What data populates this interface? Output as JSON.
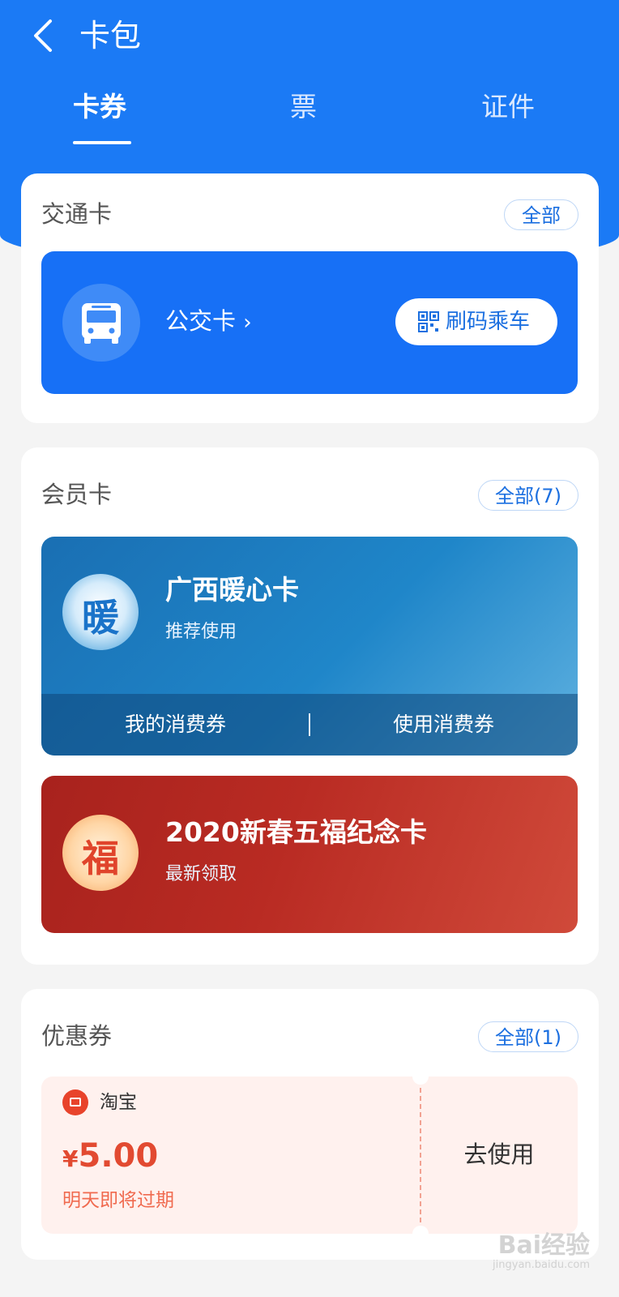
{
  "header": {
    "title": "卡包"
  },
  "tabs": [
    {
      "label": "卡券"
    },
    {
      "label": "票"
    },
    {
      "label": "证件"
    }
  ],
  "transit": {
    "section_title": "交通卡",
    "all_label": "全部",
    "bus_card_label": "公交卡",
    "ride_button": "刷码乘车",
    "icon": "bus-icon"
  },
  "membership": {
    "section_title": "会员卡",
    "all_label": "全部(7)",
    "cards": [
      {
        "avatar_glyph": "暖",
        "title": "广西暖心卡",
        "subtitle": "推荐使用",
        "actions": [
          "我的消费券",
          "使用消费券"
        ]
      },
      {
        "avatar_glyph": "福",
        "title": "2020新春五福纪念卡",
        "subtitle": "最新领取"
      }
    ]
  },
  "coupons": {
    "section_title": "优惠券",
    "all_label": "全部(1)",
    "items": [
      {
        "merchant": "淘宝",
        "currency": "¥",
        "amount": "5.00",
        "expire_note": "明天即将过期",
        "action": "去使用"
      }
    ]
  },
  "watermark": {
    "text": "Bai经验",
    "sub": "jingyan.baidu.com"
  },
  "colors": {
    "primary": "#1b7af5",
    "bus_card": "#1770f6",
    "coupon_red": "#e24a31",
    "background": "#f4f4f4"
  }
}
